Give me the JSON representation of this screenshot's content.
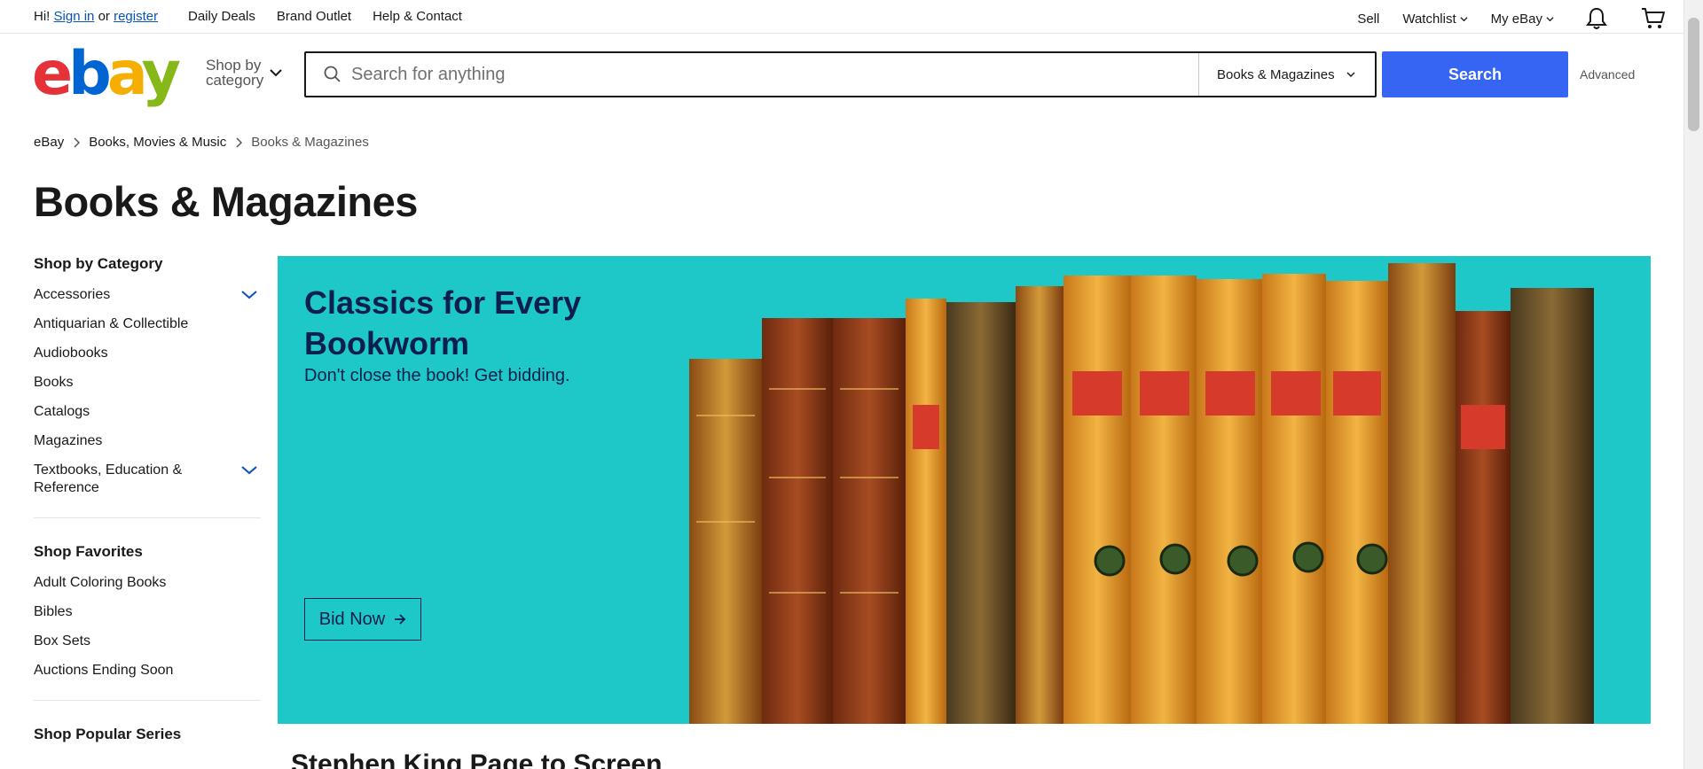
{
  "topbar": {
    "greeting": "Hi!",
    "sign_in": "Sign in",
    "or": "or",
    "register": "register",
    "nav": [
      "Daily Deals",
      "Brand Outlet",
      "Help & Contact"
    ],
    "sell": "Sell",
    "watchlist": "Watchlist",
    "my_ebay": "My eBay"
  },
  "header": {
    "logo": {
      "e": "e",
      "b": "b",
      "a": "a",
      "y": "y"
    },
    "shop_by_category": "Shop by category",
    "search_placeholder": "Search for anything",
    "search_category": "Books & Magazines",
    "search_button": "Search",
    "advanced": "Advanced"
  },
  "breadcrumb": [
    "eBay",
    "Books, Movies & Music",
    "Books & Magazines"
  ],
  "page_title": "Books & Magazines",
  "sidebar": {
    "shop_by_category": {
      "title": "Shop by Category",
      "items": [
        "Accessories",
        "Antiquarian & Collectible",
        "Audiobooks",
        "Books",
        "Catalogs",
        "Magazines",
        "Textbooks, Education & Reference"
      ]
    },
    "shop_favorites": {
      "title": "Shop Favorites",
      "items": [
        "Adult Coloring Books",
        "Bibles",
        "Box Sets",
        "Auctions Ending Soon"
      ]
    },
    "shop_popular_series": {
      "title": "Shop Popular Series"
    }
  },
  "hero": {
    "title": "Classics for Every Bookworm",
    "subtitle": "Don't close the book! Get bidding.",
    "cta": "Bid Now",
    "background_color": "#1ec8c8"
  },
  "next_section_title": "Stephen King Page to Screen",
  "colors": {
    "accent": "#3665f3",
    "link": "#0654ba",
    "hero_text": "#0b1f4f"
  }
}
